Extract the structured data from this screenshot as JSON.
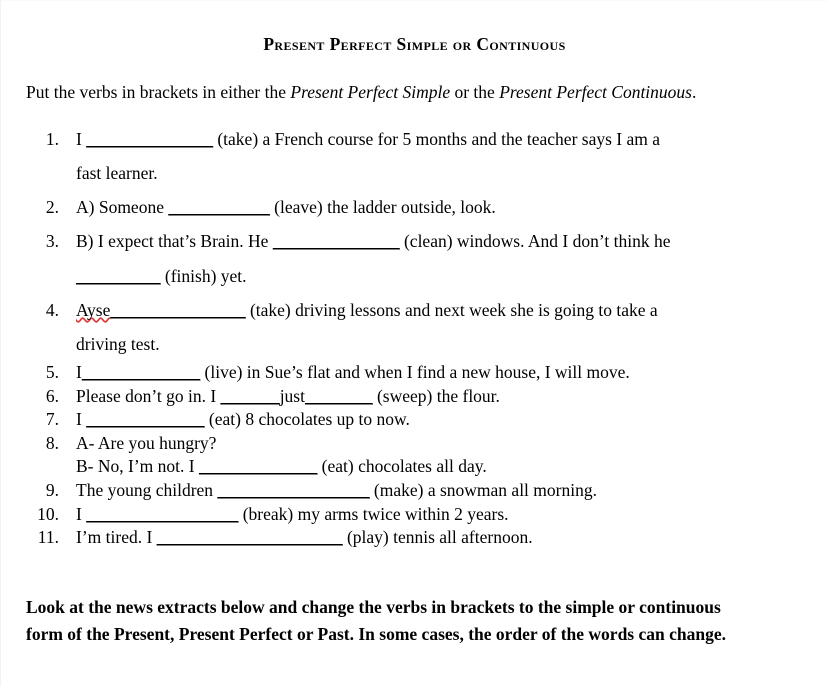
{
  "document": {
    "title": "Present Perfect Simple or Continuous",
    "intro": {
      "part1": "Put the verbs in brackets in either the ",
      "italic1": "Present Perfect Simple",
      "part2": " or the ",
      "italic2": "Present Perfect Continuous",
      "part3": "."
    },
    "items": [
      {
        "number": "1.",
        "lines": [
          {
            "segments": [
              {
                "type": "text",
                "value": "I "
              },
              {
                "type": "blank",
                "value": "_______________"
              },
              {
                "type": "text",
                "value": " (take) a French course for 5 months and the teacher says I am a"
              }
            ]
          },
          {
            "segments": [
              {
                "type": "text",
                "value": "fast learner."
              }
            ]
          }
        ]
      },
      {
        "number": "2.",
        "lines": [
          {
            "segments": [
              {
                "type": "text",
                "value": "A) Someone "
              },
              {
                "type": "blank",
                "value": "____________"
              },
              {
                "type": "text",
                "value": " (leave) the ladder outside, look."
              }
            ]
          }
        ]
      },
      {
        "number": "3.",
        "lines": [
          {
            "segments": [
              {
                "type": "text",
                "value": "B) I expect that’s Brain. He "
              },
              {
                "type": "blank",
                "value": "_______________"
              },
              {
                "type": "text",
                "value": " (clean) windows.  And I don’t think he"
              }
            ]
          },
          {
            "segments": [
              {
                "type": "blank",
                "value": "__________"
              },
              {
                "type": "text",
                "value": " (finish) yet."
              }
            ]
          }
        ]
      },
      {
        "number": "4.",
        "lines": [
          {
            "segments": [
              {
                "type": "misspelled",
                "value": "Ayse"
              },
              {
                "type": "blank",
                "value": "________________"
              },
              {
                "type": "text",
                "value": " (take) driving lessons and next week she is going to take a"
              }
            ]
          },
          {
            "segments": [
              {
                "type": "text",
                "value": "driving test."
              }
            ]
          }
        ]
      },
      {
        "number": "5.",
        "lines": [
          {
            "segments": [
              {
                "type": "text",
                "value": "I"
              },
              {
                "type": "blank",
                "value": "______________"
              },
              {
                "type": "text",
                "value": " (live) in Sue’s flat and when I find a new house, I will move."
              }
            ]
          }
        ]
      },
      {
        "number": "6.",
        "lines": [
          {
            "segments": [
              {
                "type": "text",
                "value": "Please don’t go in. I "
              },
              {
                "type": "blank",
                "value": "_______"
              },
              {
                "type": "text",
                "value": "just"
              },
              {
                "type": "blank",
                "value": "________"
              },
              {
                "type": "text",
                "value": " (sweep) the flour."
              }
            ]
          }
        ]
      },
      {
        "number": "7.",
        "lines": [
          {
            "segments": [
              {
                "type": "text",
                "value": "I "
              },
              {
                "type": "blank",
                "value": "______________"
              },
              {
                "type": "text",
                "value": " (eat) 8 chocolates up to now."
              }
            ]
          }
        ]
      },
      {
        "number": "8.",
        "lines": [
          {
            "segments": [
              {
                "type": "text",
                "value": "A- Are you hungry?"
              }
            ]
          },
          {
            "segments": [
              {
                "type": "text",
                "value": "B- No, I’m not. I "
              },
              {
                "type": "blank",
                "value": "______________"
              },
              {
                "type": "text",
                "value": " (eat) chocolates all day."
              }
            ]
          }
        ]
      },
      {
        "number": "9.",
        "lines": [
          {
            "segments": [
              {
                "type": "text",
                "value": "The young children "
              },
              {
                "type": "blank",
                "value": "__________________"
              },
              {
                "type": "text",
                "value": " (make) a snowman all morning."
              }
            ]
          }
        ]
      },
      {
        "number": "10.",
        "lines": [
          {
            "segments": [
              {
                "type": "text",
                "value": "I "
              },
              {
                "type": "blank",
                "value": "__________________"
              },
              {
                "type": "text",
                "value": " (break) my arms twice within 2 years."
              }
            ]
          }
        ]
      },
      {
        "number": "11.",
        "lines": [
          {
            "segments": [
              {
                "type": "text",
                "value": "I’m tired. I "
              },
              {
                "type": "blank",
                "value": "______________________"
              },
              {
                "type": "text",
                "value": " (play) tennis all afternoon."
              }
            ]
          }
        ]
      }
    ],
    "closing": "Look at the news extracts below and change the verbs in brackets to the simple  or continuous  form  of the Present, Present Perfect or Past. In some cases, the order  of the words  can change."
  },
  "colors": {
    "text": "#000000",
    "background": "#ffffff",
    "spellcheck_underline": "#e03a3a"
  }
}
